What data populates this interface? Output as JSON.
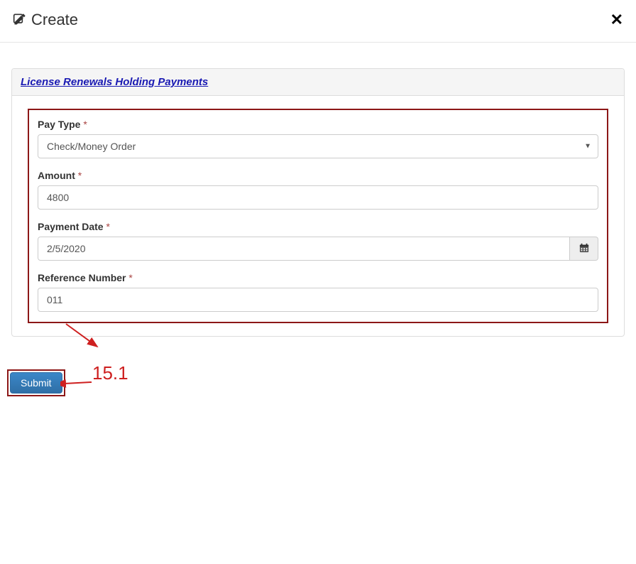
{
  "header": {
    "title": "Create"
  },
  "panel": {
    "title_link": "License Renewals Holding Payments"
  },
  "form": {
    "pay_type": {
      "label": "Pay Type",
      "value": "Check/Money Order"
    },
    "amount": {
      "label": "Amount",
      "value": "4800"
    },
    "payment_date": {
      "label": "Payment Date",
      "value": "2/5/2020"
    },
    "reference_number": {
      "label": "Reference Number",
      "value": "011"
    }
  },
  "buttons": {
    "submit": "Submit"
  },
  "annotation": {
    "callout": "15.1"
  }
}
